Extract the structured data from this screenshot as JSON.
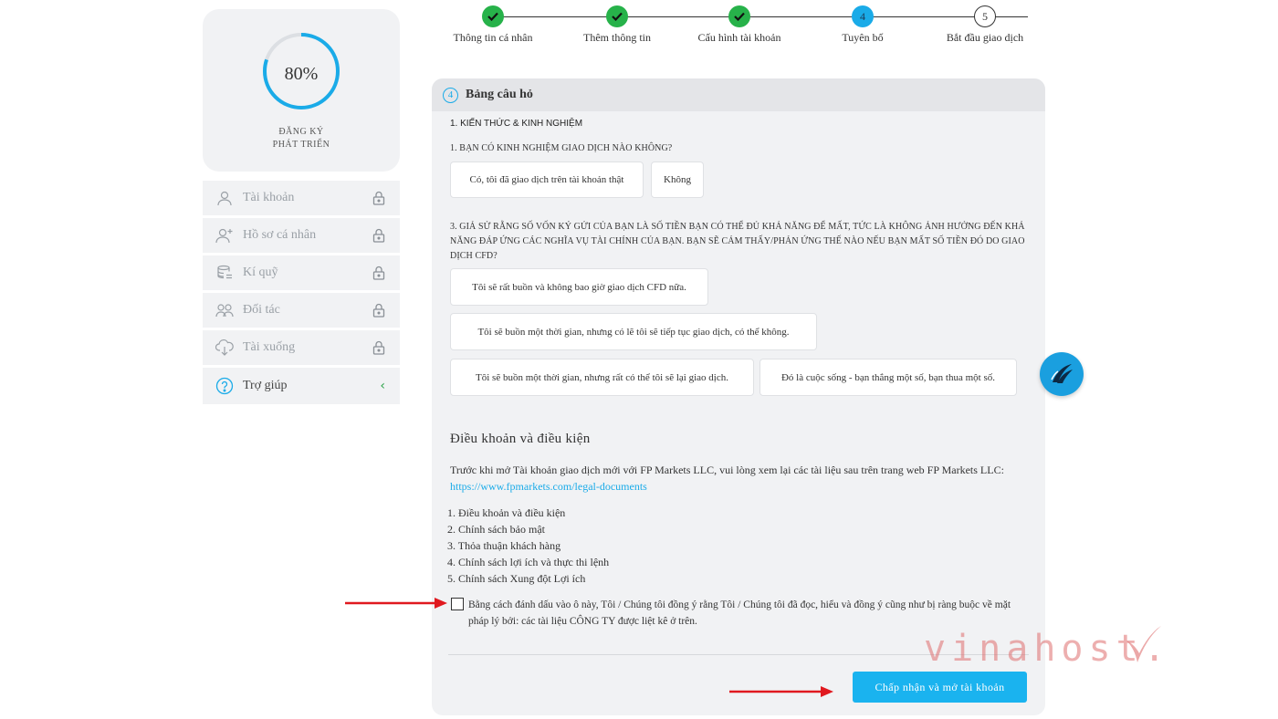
{
  "progress": {
    "percent_label": "80%",
    "value": 0.8,
    "status_line1": "ĐĂNG KÝ",
    "status_line2": "PHÁT TRIỂN"
  },
  "sidebar": {
    "items": [
      {
        "label": "Tài khoản",
        "icon": "user-icon",
        "locked": true
      },
      {
        "label": "Hồ sơ cá nhân",
        "icon": "user-add-icon",
        "locked": true
      },
      {
        "label": "Kí quỹ",
        "icon": "coins-icon",
        "locked": true
      },
      {
        "label": "Đối tác",
        "icon": "partners-icon",
        "locked": true
      },
      {
        "label": "Tài xuống",
        "icon": "cloud-download-icon",
        "locked": true
      },
      {
        "label": "Trợ giúp",
        "icon": "help-icon",
        "chevron": "‹"
      }
    ]
  },
  "stepper": {
    "steps": [
      {
        "label": "Thông tin cá nhân",
        "state": "done"
      },
      {
        "label": "Thêm thông tin",
        "state": "done"
      },
      {
        "label": "Cấu hình tài khoản",
        "state": "done"
      },
      {
        "label": "Tuyên bố",
        "state": "current",
        "number": "4"
      },
      {
        "label": "Bắt đầu giao dịch",
        "state": "pending",
        "number": "5"
      }
    ]
  },
  "card": {
    "number": "4",
    "title": "Bảng câu hỏ",
    "section_title": "1. KIẾN THỨC & KINH NGHIỆM",
    "q1": {
      "text": "1. BẠN CÓ KINH NGHIỆM GIAO DỊCH NÀO KHÔNG?",
      "options": [
        "Có, tôi đã giao dịch trên tài khoản thật",
        "Không"
      ]
    },
    "q3": {
      "text": "3. GIẢ SỬ RẰNG SỐ VỐN KÝ GỬI CỦA BẠN LÀ SỐ TIỀN BẠN CÓ THỂ ĐỦ KHẢ NĂNG ĐỂ MẤT, TỨC LÀ KHÔNG ẢNH HƯỞNG ĐẾN KHẢ NĂNG ĐÁP ỨNG CÁC NGHĨA VỤ TÀI CHÍNH CỦA BẠN. BẠN SẼ CẢM THẤY/PHẢN ỨNG THẾ NÀO NẾU BẠN MẤT SỐ TIỀN ĐÓ DO GIAO DỊCH CFD?",
      "options": [
        "Tôi sẽ rất buồn và không bao giờ giao dịch CFD nữa.",
        "Tôi sẽ buồn một thời gian, nhưng có lẽ tôi sẽ tiếp tục giao dịch, có thể không.",
        "Tôi sẽ buồn một thời gian, nhưng rất có thể tôi sẽ lại giao dịch.",
        "Đó là cuộc sống - bạn thắng một số, bạn thua một số."
      ]
    },
    "terms": {
      "title": "Điều khoản và điều kiện",
      "paragraph": "Trước khi mở Tài khoản giao dịch mới với FP Markets LLC, vui lòng xem lại các tài liệu sau trên trang web FP Markets LLC: ",
      "link": "https://www.fpmarkets.com/legal-documents",
      "documents": [
        "1. Điều khoản và điều kiện",
        "2. Chính sách bảo mật",
        "3. Thỏa thuận khách hàng",
        "4. Chính sách lợi ích và thực thi lệnh",
        "5. Chính sách Xung đột Lợi ích"
      ],
      "agree_text": "Bằng cách đánh dấu vào ô này, Tôi / Chúng tôi đồng ý rằng Tôi / Chúng tôi đã đọc, hiểu và đồng ý cũng như bị ràng buộc về mặt pháp lý bởi: các tài liệu CÔNG TY được liệt kê ở trên.",
      "agree_checked": false
    },
    "accept_button": "Chấp nhận và mở tài khoản"
  },
  "watermark": "vinahost.",
  "colors": {
    "accent": "#1ab3ef",
    "done": "#27b24a",
    "arrow": "#e0191f",
    "card_bg": "#f1f2f4"
  }
}
